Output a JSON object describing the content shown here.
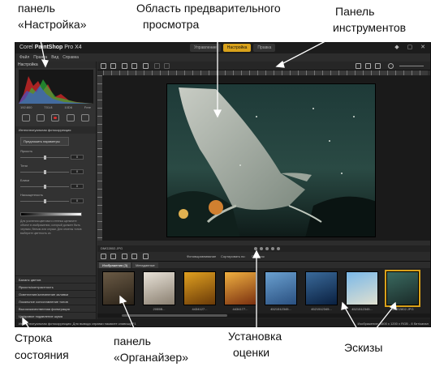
{
  "annotations": {
    "settings_panel": [
      "панель",
      "«Настройка»"
    ],
    "preview_area": [
      "Область предварительного",
      "просмотра"
    ],
    "toolbar": [
      "Панель",
      "инструментов"
    ],
    "status_bar": [
      "Строка",
      "состояния"
    ],
    "organizer": [
      "панель",
      "«Органайзер»"
    ],
    "rating": [
      "Установка",
      "оценки"
    ],
    "thumbnails": "Эскизы"
  },
  "app": {
    "title_prefix": "Corel",
    "title_brand": "PaintShop",
    "title_suffix": "Pro X4",
    "tabs": [
      {
        "label": "Управление",
        "active": false
      },
      {
        "label": "Настройка",
        "active": true
      },
      {
        "label": "Правка",
        "active": false
      }
    ],
    "menu": [
      "Файл",
      "Правка",
      "Вид",
      "Справка"
    ],
    "left_panel": {
      "header": "Настройка",
      "histogram_values": [
        "192:800",
        "T01:8",
        "10D6",
        "Free"
      ],
      "section_title": "Интеллектуальная фотокоррекция",
      "preset_button": "Предложить параметры",
      "sliders": [
        {
          "label": "Яркость",
          "value": "0",
          "level": 0.5
        },
        {
          "label": "Тени",
          "value": "0",
          "level": 0.5
        },
        {
          "label": "Блики",
          "value": "0",
          "level": 0.5
        },
        {
          "label": "Насыщенность",
          "value": "0",
          "level": 0.5
        }
      ],
      "hint": "Для усиления цветового оттенка щелкните объект в изображении, который должен быть черным, белым или серым. Для отмены тонов выберите цветность из",
      "collapsed_sections": [
        "Баланс цветов",
        "Яркость/контрастность",
        "Осветление/затемнение заливки",
        "Локальное сопоставление тонов",
        "Высококачественная фильтрация",
        "Цифровое подавление шума"
      ]
    },
    "filmstrip": {
      "current_file": "DMG2802.JPG",
      "rating_dots": 5,
      "tabs": [
        {
          "label": "Изображения (3)",
          "active": true
        },
        {
          "label": "Метаданные",
          "active": false
        }
      ],
      "toolbar_labels": [
        "Фотовыравнивание",
        "Сортировать по:",
        "Пометок"
      ],
      "thumbnails": [
        {
          "label": "",
          "colors": [
            "#6a5a45",
            "#2a2218"
          ]
        },
        {
          "label": "2055B...",
          "colors": [
            "#e8e2d8",
            "#8a7f70"
          ]
        },
        {
          "label": "4434127...",
          "colors": [
            "#e0a020",
            "#6a3a08"
          ]
        },
        {
          "label": "4434177...",
          "colors": [
            "#f0b040",
            "#7a3010"
          ]
        },
        {
          "label": "4521512345...",
          "colors": [
            "#6aa0d0",
            "#2a5080"
          ]
        },
        {
          "label": "4521512345...",
          "colors": [
            "#3a6a9a",
            "#0a2040"
          ]
        },
        {
          "label": "4521512345...",
          "colors": [
            "#7ab8e8",
            "#e0e0d0"
          ]
        },
        {
          "label": "DMG2802.JPG",
          "colors": [
            "#3a6a60",
            "#1a2a28"
          ]
        }
      ]
    },
    "status_left": "Интеллектуальная фотокоррекция: Для вывода справки нажмите клавишу F1",
    "status_right": "Изображение: 1600 x 1200 x RGB - 8 бит/канал"
  }
}
